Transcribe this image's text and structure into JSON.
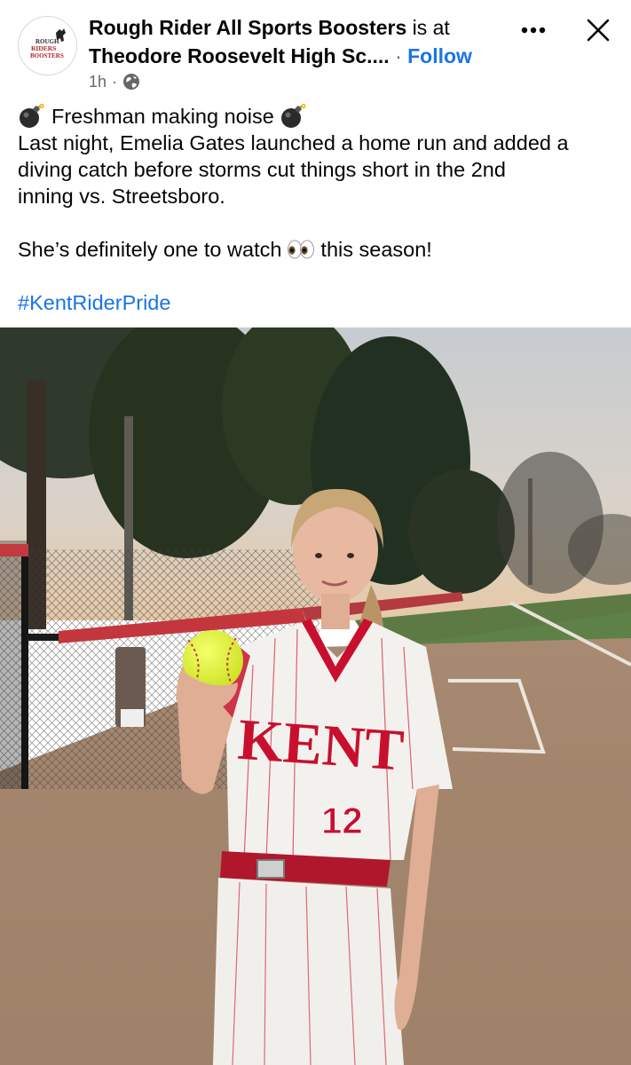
{
  "post": {
    "author": "Rough Rider All Sports Boosters",
    "is_at": "is at",
    "location_truncated": "Theodore Roosevelt High Sc....",
    "separator": "·",
    "follow_label": "Follow",
    "timestamp": "1h",
    "meta_separator": "·",
    "privacy_icon": "globe-icon",
    "avatar_logo_text": [
      "ROUGH",
      "RIDERS",
      "BOOSTERS"
    ]
  },
  "text": {
    "headline": "Freshman making noise",
    "lines": [
      "Last night, Emelia Gates launched a home run and added a",
      "diving catch before storms cut things short in the 2nd",
      "inning vs. Streetsboro."
    ],
    "watch_before": "She’s definitely one to watch",
    "watch_after": "this season!",
    "hashtag": "#KentRiderPride"
  },
  "photo": {
    "jersey_text": "KENT",
    "jersey_number": "12"
  },
  "colors": {
    "link": "#1b74e4",
    "secondary_text": "#65676b",
    "jersey_red": "#c8102e"
  }
}
